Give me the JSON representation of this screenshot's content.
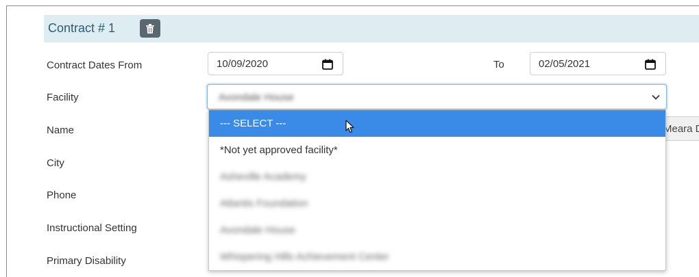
{
  "section": {
    "title": "Contract # 1",
    "delete_icon": "trash-icon"
  },
  "form": {
    "contract_dates_label": "Contract Dates From",
    "from_date": "10/09/2020",
    "to_label": "To",
    "to_date": "02/05/2021",
    "calendar_icon": "calendar-icon",
    "facility_label": "Facility",
    "facility_selected": "Avondale House",
    "chevron_icon": "chevron-down-icon",
    "name_label": "Name",
    "name_value_partial": "Meara D",
    "city_label": "City",
    "phone_label": "Phone",
    "instructional_setting_label": "Instructional Setting",
    "primary_disability_label": "Primary Disability"
  },
  "facility_dropdown": {
    "options": [
      "--- SELECT ---",
      "*Not yet approved facility*",
      "Asheville Academy",
      "Atlantis Foundation",
      "Avondale House",
      "Whispering Hills Achievement Center"
    ],
    "highlighted_index": 0
  },
  "colors": {
    "header_bg": "#deedf1",
    "header_text": "#2b5d78",
    "highlight": "#3a8ae8"
  }
}
